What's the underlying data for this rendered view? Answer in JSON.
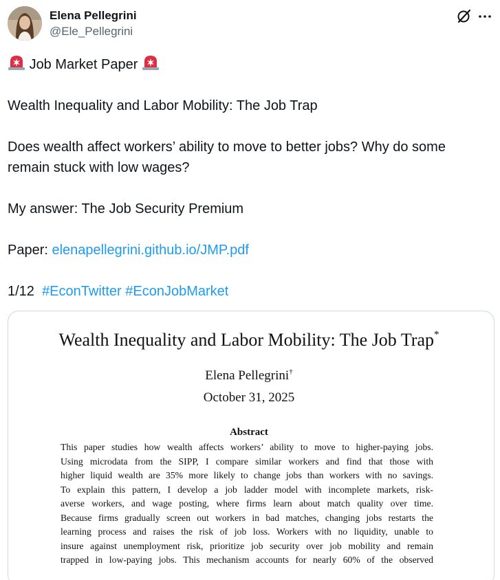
{
  "author": {
    "display_name": "Elena Pellegrini",
    "handle": "@Ele_Pellegrini"
  },
  "icons": {
    "grok": "grok-icon",
    "more": "more-dots-icon",
    "siren": "rotating-light-emoji"
  },
  "tweet": {
    "line1": "Job Market Paper",
    "line2": "Wealth Inequality and Labor Mobility: The Job Trap",
    "line3": "Does wealth affect workers’ ability to move to better jobs? Why do some",
    "line4": "remain stuck with low wages?",
    "line5": "My answer: The Job Security Premium",
    "paper_prefix": "Paper: ",
    "paper_link": "elenapellegrini.github.io/JMP.pdf",
    "thread_count": "1/12",
    "hashtag1": "#EconTwitter",
    "hashtag2": "#EconJobMarket"
  },
  "paper": {
    "title": "Wealth Inequality and Labor Mobility: The Job Trap",
    "title_mark": "*",
    "author": "Elena Pellegrini",
    "author_mark": "†",
    "date": "October 31, 2025",
    "abstract_heading": "Abstract",
    "abstract_lines": [
      "This paper studies how wealth affects workers’ ability to move to higher-paying jobs.",
      "Using microdata from the SIPP, I compare similar workers and find that those with",
      "higher liquid wealth are 35% more likely to change jobs than workers with no savings.",
      "To explain this pattern, I develop a job ladder model with incomplete markets, risk-",
      "averse workers, and wage posting, where firms learn about match quality over time.",
      "Because firms gradually screen out workers in bad matches, changing jobs restarts the",
      "learning process and raises the risk of job loss. Workers with no liquidity, unable to",
      "insure against unemployment risk, prioritize job security over job mobility and remain",
      "trapped in low-paying jobs. This mechanism accounts for nearly 60% of the observed"
    ]
  },
  "colors": {
    "text": "#0f1419",
    "secondary": "#536471",
    "link": "#1d9bf0",
    "border": "#cfd9de"
  }
}
